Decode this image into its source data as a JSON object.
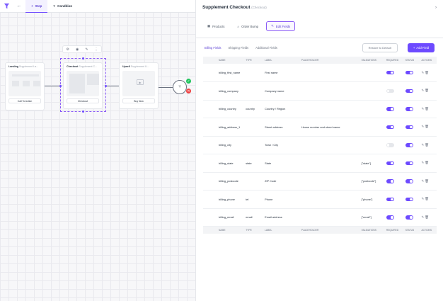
{
  "topbar": {
    "step_label": "Step",
    "condition_label": "Condition"
  },
  "canvas": {
    "nodes": [
      {
        "title": "Landing",
        "subtitle": "Supplement La...",
        "button": "Call To Action"
      },
      {
        "title": "Checkout",
        "subtitle": "Supplement C...",
        "button": "Checkout"
      },
      {
        "title": "Upsell",
        "subtitle": "Supplement U...",
        "button": "Buy Now"
      }
    ],
    "condition_yes": "✓",
    "condition_no": "✕"
  },
  "panel": {
    "title": "Supplement Checkout",
    "title_suffix": "(Checkout)",
    "tabs": [
      {
        "label": "Products",
        "icon": "box-icon"
      },
      {
        "label": "Order Bump",
        "icon": "bump-icon"
      },
      {
        "label": "Edit Fields",
        "icon": "pencil-icon",
        "active": true
      }
    ],
    "sub_tabs": [
      "Billing Fields",
      "Shipping Fields",
      "Additional Fields"
    ],
    "restore_label": "Restore to Default",
    "add_field_label": "Add Field",
    "columns": [
      "NAME",
      "TYPE",
      "LABEL",
      "PLACEHOLDER",
      "VALIDATIONS",
      "REQUIRED",
      "STATUS",
      "ACTIONS"
    ],
    "rows": [
      {
        "name": "billing_first_name",
        "type": "",
        "label": "First name",
        "placeholder": "",
        "validations": "",
        "required": true,
        "status": true
      },
      {
        "name": "billing_company",
        "type": "",
        "label": "Company name",
        "placeholder": "",
        "validations": "",
        "required": false,
        "status": true
      },
      {
        "name": "billing_country",
        "type": "country",
        "label": "Country / Region",
        "placeholder": "",
        "validations": "",
        "required": true,
        "status": true
      },
      {
        "name": "billing_address_1",
        "type": "",
        "label": "Street address",
        "placeholder": "House number and street name",
        "validations": "",
        "required": true,
        "status": true
      },
      {
        "name": "billing_city",
        "type": "",
        "label": "Town / City",
        "placeholder": "",
        "validations": "",
        "required": false,
        "status": true
      },
      {
        "name": "billing_state",
        "type": "state",
        "label": "State",
        "placeholder": "",
        "validations": "[\"state\"]",
        "required": true,
        "status": true
      },
      {
        "name": "billing_postcode",
        "type": "",
        "label": "ZIP Code",
        "placeholder": "",
        "validations": "[\"postcode\"]",
        "required": true,
        "status": true
      },
      {
        "name": "billing_phone",
        "type": "tel",
        "label": "Phone",
        "placeholder": "",
        "validations": "[\"phone\"]",
        "required": true,
        "status": true
      },
      {
        "name": "billing_email",
        "type": "email",
        "label": "Email address",
        "placeholder": "",
        "validations": "[\"email\"]",
        "required": true,
        "status": true
      }
    ]
  },
  "colors": {
    "accent": "#6d4aff",
    "success": "#22c55e",
    "danger": "#ef4444"
  }
}
